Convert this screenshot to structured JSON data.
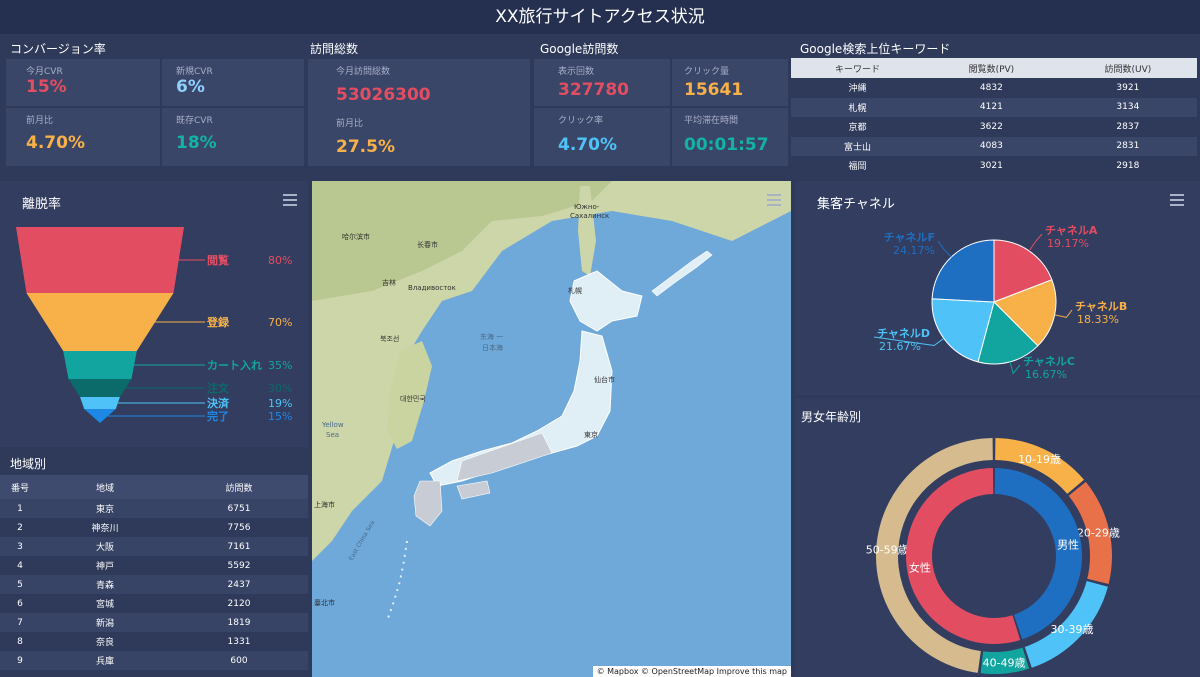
{
  "header": {
    "title": "XX旅行サイトアクセス状況"
  },
  "conversion": {
    "section": "コンバージョン率",
    "monthly_cvr": {
      "label": "今月CVR",
      "value": "15%"
    },
    "new_cvr": {
      "label": "新規CVR",
      "value": "6%"
    },
    "mom": {
      "label": "前月比",
      "value": "4.70%"
    },
    "existing_cvr": {
      "label": "既存CVR",
      "value": "18%"
    }
  },
  "visits": {
    "section": "訪問総数",
    "total": {
      "label": "今月訪問総数",
      "value": "53026300"
    },
    "mom": {
      "label": "前月比",
      "value": "27.5%"
    }
  },
  "google_visits": {
    "section": "Google訪問数",
    "impressions": {
      "label": "表示回数",
      "value": "327780"
    },
    "clicks": {
      "label": "クリック量",
      "value": "15641"
    },
    "ctr": {
      "label": "クリック率",
      "value": "4.70%"
    },
    "avg_time": {
      "label": "平均滞在時間",
      "value": "00:01:57"
    }
  },
  "keywords": {
    "section": "Google検索上位キーワード",
    "columns": [
      "キーワード",
      "閲覧数(PV)",
      "訪問数(UV)"
    ],
    "rows": [
      [
        "沖縄",
        "4832",
        "3921"
      ],
      [
        "札幌",
        "4121",
        "3134"
      ],
      [
        "京都",
        "3622",
        "2837"
      ],
      [
        "富士山",
        "4083",
        "2831"
      ],
      [
        "福岡",
        "3021",
        "2918"
      ]
    ]
  },
  "funnel": {
    "title": "離脱率",
    "stages": [
      {
        "name": "閲覧",
        "pct": "80%",
        "value": 80,
        "color": "#e34d62"
      },
      {
        "name": "登録",
        "pct": "70%",
        "value": 70,
        "color": "#f8b148"
      },
      {
        "name": "カート入れ",
        "pct": "35%",
        "value": 35,
        "color": "#12a5a0"
      },
      {
        "name": "注文",
        "pct": "30%",
        "value": 30,
        "color": "#0b6a6a"
      },
      {
        "name": "決済",
        "pct": "19%",
        "value": 19,
        "color": "#4fc3f7"
      },
      {
        "name": "完了",
        "pct": "15%",
        "value": 15,
        "color": "#1e88e5"
      }
    ]
  },
  "regions": {
    "section": "地域別",
    "columns": [
      "番号",
      "地域",
      "訪問数"
    ],
    "rows": [
      [
        "1",
        "東京",
        "6751"
      ],
      [
        "2",
        "神奈川",
        "7756"
      ],
      [
        "3",
        "大阪",
        "7161"
      ],
      [
        "4",
        "神戸",
        "5592"
      ],
      [
        "5",
        "青森",
        "2437"
      ],
      [
        "6",
        "宮城",
        "2120"
      ],
      [
        "7",
        "新潟",
        "1819"
      ],
      [
        "8",
        "奈良",
        "1331"
      ],
      [
        "9",
        "兵庫",
        "600"
      ]
    ]
  },
  "map": {
    "labels": {
      "yuzhno": "Южно-",
      "sakhalinsk": "Сахалинск",
      "harbin": "哈尔滨市",
      "changchun": "长春市",
      "jilin": "吉林",
      "vladivostok": "Владивосток",
      "sapporo": "札幌",
      "sea": "东海 一",
      "japan_sea": "日本海",
      "sendai": "仙台市",
      "korea": "대한민국",
      "nk": "북조선",
      "yellow": "Yellow",
      "sea2": "Sea",
      "east_china": "East China Sea",
      "shanghai": "上海市",
      "taipei": "臺北市",
      "tokyo": "東京"
    },
    "attribution": "© Mapbox © OpenStreetMap Improve this map"
  },
  "channels": {
    "title": "集客チャネル",
    "slices": [
      {
        "name": "チャネルA",
        "pct": "19.17%",
        "value": 19.17,
        "color": "#e34d62"
      },
      {
        "name": "チャネルB",
        "pct": "18.33%",
        "value": 18.33,
        "color": "#f8b148"
      },
      {
        "name": "チャネルC",
        "pct": "16.67%",
        "value": 16.67,
        "color": "#12a5a0"
      },
      {
        "name": "チャネルD",
        "pct": "21.67%",
        "value": 21.67,
        "color": "#4fc3f7"
      },
      {
        "name": "チャネルF",
        "pct": "24.17%",
        "value": 24.17,
        "color": "#1e6fc2"
      }
    ]
  },
  "gender_age": {
    "title": "男女年齢別",
    "inner": [
      {
        "name": "男性",
        "value": 45,
        "color": "#1e6fc2"
      },
      {
        "name": "女性",
        "value": 55,
        "color": "#e34d62"
      }
    ],
    "outer": [
      {
        "name": "10-19歳",
        "value": 14,
        "color": "#f8b148"
      },
      {
        "name": "20-29歳",
        "value": 15,
        "color": "#e8714a"
      },
      {
        "name": "30-39歳",
        "value": 16,
        "color": "#4fc3f7"
      },
      {
        "name": "40-49歳",
        "value": 7,
        "color": "#12a5a0"
      },
      {
        "name": "50-59歳",
        "value": 48,
        "color": "#d6bb8e"
      }
    ]
  }
}
